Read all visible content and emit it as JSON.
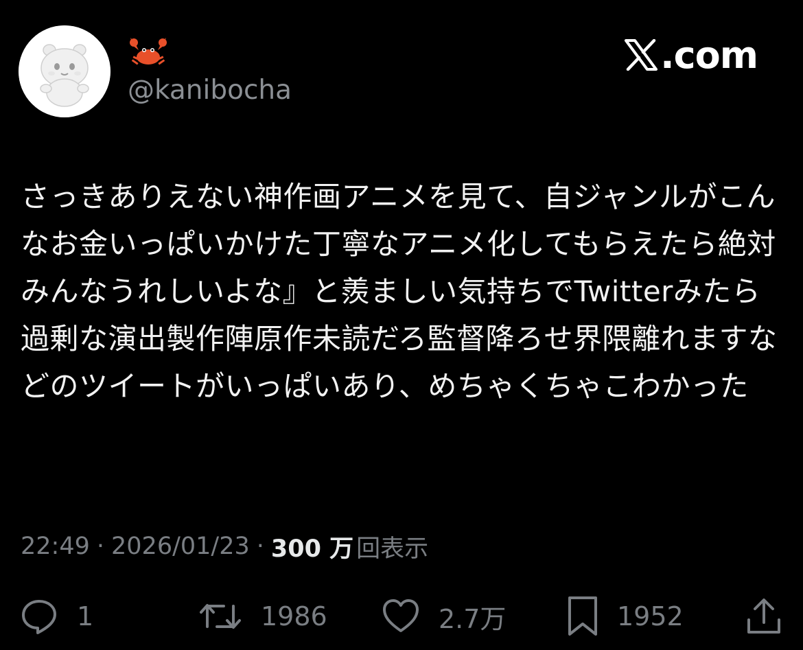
{
  "header": {
    "display_name_icon": "crab-emoji",
    "handle": "@kanibocha",
    "site_logo_text": ".com",
    "site_logo_icon": "x-logo-icon"
  },
  "tweet": {
    "text": "さっきありえない神作画アニメを見て、自ジャンルがこんなお金いっぱいかけた丁寧なアニメ化してもらえたら絶対みんなうれしいよな』と羨ましい気持ちでTwitterみたら過剰な演出製作陣原作未読だろ監督降ろせ界隈離れますなどのツイートがいっぱいあり、めちゃくちゃこわかった"
  },
  "meta": {
    "time": "22:49",
    "separator": "·",
    "date": "2026/01/23",
    "views_count": "300 万",
    "views_label": "回表示"
  },
  "actions": {
    "reply_count": "1",
    "retweet_count": "1986",
    "like_count": "2.7万",
    "bookmark_count": "1952"
  },
  "colors": {
    "background": "#000000",
    "primary_text": "#e7e9ea",
    "secondary_text": "#7a7e83",
    "crab": "#e8502a"
  }
}
